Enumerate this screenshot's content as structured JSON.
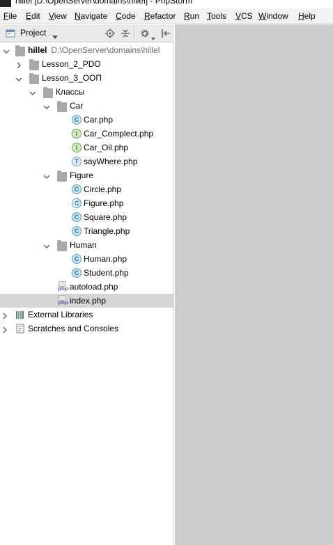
{
  "window": {
    "title": "hillel [D:\\OpenServer\\domains\\hillel] - PhpStorm"
  },
  "menu": [
    {
      "key": "file",
      "label": "File"
    },
    {
      "key": "edit",
      "label": "Edit"
    },
    {
      "key": "view",
      "label": "View"
    },
    {
      "key": "navigate",
      "label": "Navigate"
    },
    {
      "key": "code",
      "label": "Code"
    },
    {
      "key": "refactor",
      "label": "Refactor"
    },
    {
      "key": "run",
      "label": "Run"
    },
    {
      "key": "tools",
      "label": "Tools"
    },
    {
      "key": "vcs",
      "label": "VCS"
    },
    {
      "key": "window",
      "label": "Window"
    },
    {
      "key": "help",
      "label": "Help"
    }
  ],
  "panel": {
    "title": "Project"
  },
  "tree": {
    "root": {
      "label": "hillel",
      "path": "D:\\OpenServer\\domains\\hillel"
    },
    "lesson2": "Lesson_2_PDO",
    "lesson3": "Lesson_3_OOП",
    "klassy": "Классы",
    "car": "Car",
    "car_php": "Car.php",
    "car_complect": "Car_Complect.php",
    "car_oil": "Car_Oil.php",
    "saywhere": "sayWhere.php",
    "figure": "Figure",
    "circle": "Circle.php",
    "figure_php": "Figure.php",
    "square": "Square.php",
    "triangle": "Triangle.php",
    "human": "Human",
    "human_php": "Human.php",
    "student": "Student.php",
    "autoload": "autoload.php",
    "index": "index.php",
    "ext_libs": "External Libraries",
    "scratches": "Scratches and Consoles"
  },
  "icon_letters": {
    "class": "C",
    "interface": "I",
    "trait": "T",
    "php": "php"
  },
  "colors": {
    "selection": "#d5d5d5",
    "editor_bg": "#cccccc",
    "path_gray": "#6d6d6d"
  }
}
